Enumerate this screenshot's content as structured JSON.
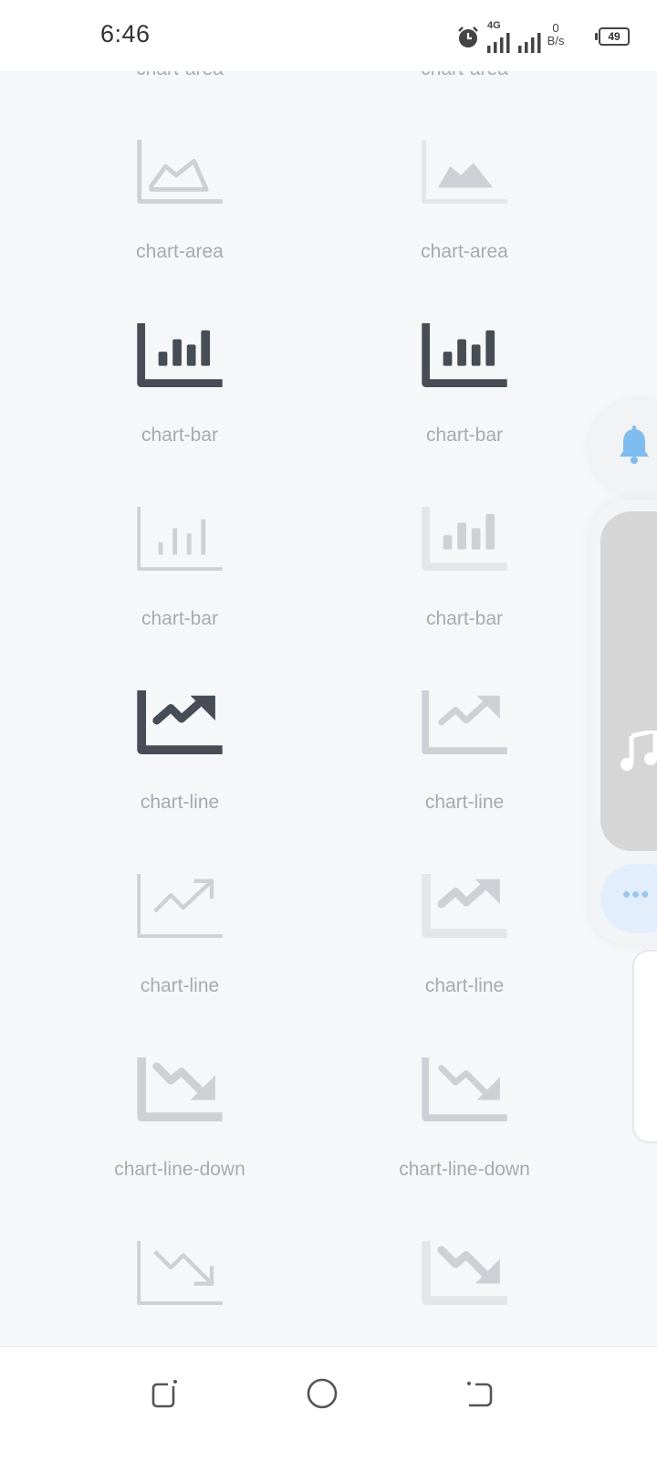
{
  "status_bar": {
    "time": "6:46",
    "network": "4G",
    "speed_value": "0",
    "speed_unit": "B/s",
    "battery": "49"
  },
  "top_partial_labels": [
    "chart-area",
    "chart-area"
  ],
  "icons": [
    {
      "label": "chart-area",
      "icon": "chart-area-outline-icon",
      "tone": "light"
    },
    {
      "label": "chart-area",
      "icon": "chart-area-filled-icon",
      "tone": "light"
    },
    {
      "label": "chart-bar",
      "icon": "chart-bar-solid-icon",
      "tone": "dark"
    },
    {
      "label": "chart-bar",
      "icon": "chart-bar-solid-icon",
      "tone": "dark"
    },
    {
      "label": "chart-bar",
      "icon": "chart-bar-thin-icon",
      "tone": "light"
    },
    {
      "label": "chart-bar",
      "icon": "chart-bar-duotone-icon",
      "tone": "light"
    },
    {
      "label": "chart-line",
      "icon": "chart-line-solid-icon",
      "tone": "dark"
    },
    {
      "label": "chart-line",
      "icon": "chart-line-regular-icon",
      "tone": "light"
    },
    {
      "label": "chart-line",
      "icon": "chart-line-thin-icon",
      "tone": "light"
    },
    {
      "label": "chart-line",
      "icon": "chart-line-duotone-icon",
      "tone": "light"
    },
    {
      "label": "chart-line-down",
      "icon": "chart-line-down-solid-icon",
      "tone": "light"
    },
    {
      "label": "chart-line-down",
      "icon": "chart-line-down-regular-icon",
      "tone": "light"
    },
    {
      "label": "",
      "icon": "chart-line-down-thin-icon",
      "tone": "light"
    },
    {
      "label": "",
      "icon": "chart-line-down-duotone-icon",
      "tone": "light"
    }
  ],
  "colors": {
    "dark_icon": "#474d55",
    "light_icon": "#cdd1d6",
    "lighter_icon": "#e3e5e8",
    "label": "#a5abb3",
    "background": "#f6f7f9"
  }
}
